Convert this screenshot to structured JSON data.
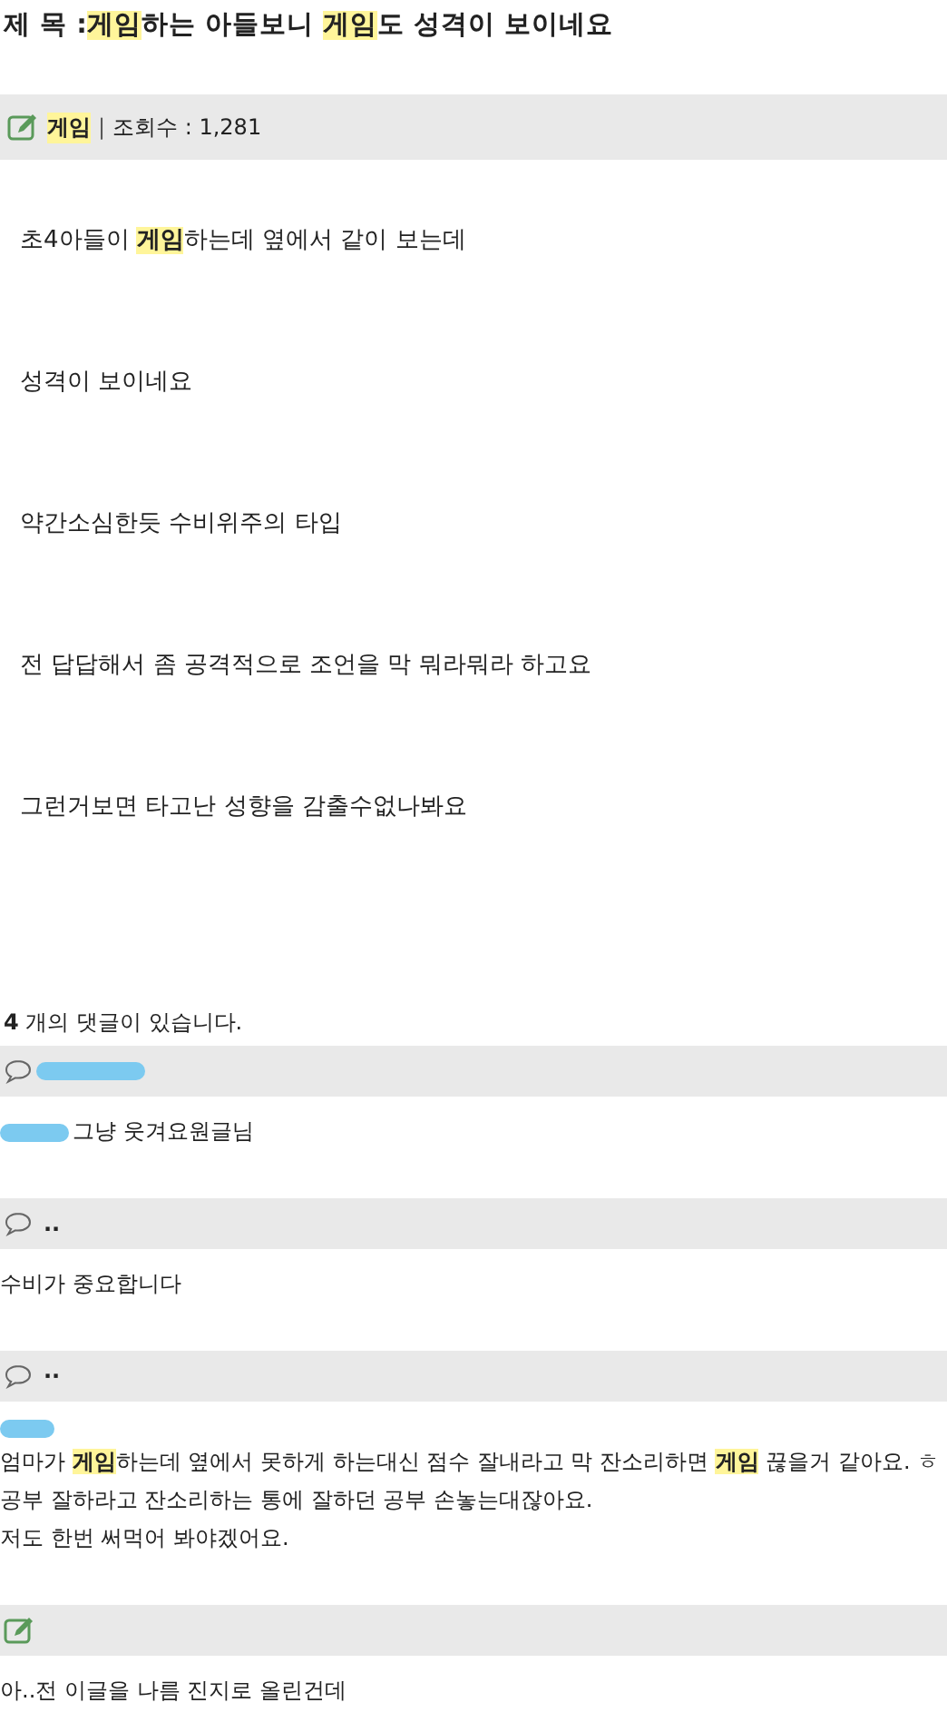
{
  "post": {
    "title_label": "제 목 :",
    "title": "**게임**하는 아들보니 **게임**도 성격이 보이네요",
    "category": "게임",
    "separator": "|",
    "views": "조회수 : 1,281",
    "paragraphs": [
      "초4아들이 **게임**하는데 옆에서 같이 보는데",
      "성격이 보이네요",
      "약간소심한듯 수비위주의 타입",
      "전 답답해서 좀 공격적으로 조언을 막 뭐라뭐라 하고요",
      "그런거보면 타고난 성향을 감출수없나봐요"
    ]
  },
  "comment_count": {
    "number": "4",
    "text": "개의 댓글이 있습니다."
  },
  "comments": [
    {
      "kind": "comment",
      "author_redacted": true,
      "body_redacted_inline": true,
      "body_redacted_above": false,
      "lines": [
        "그냥 웃겨요원글님"
      ]
    },
    {
      "kind": "comment",
      "author": "..",
      "author_redacted": false,
      "body_redacted_inline": false,
      "body_redacted_above": false,
      "lines": [
        "수비가 중요합니다"
      ]
    },
    {
      "kind": "comment",
      "author": "··",
      "author_redacted": false,
      "body_redacted_inline": false,
      "body_redacted_above": true,
      "lines": [
        "엄마가 **게임**하는데 옆에서 못하게 하는대신 점수 잘내라고 막 잔소리하면 **게임** 끊을거 같아요. ㅎ",
        "공부 잘하라고 잔소리하는 통에 잘하던 공부 손놓는대잖아요.",
        "저도 한번 써먹어 봐야겠어요."
      ]
    },
    {
      "kind": "edit",
      "author_redacted": false,
      "body_redacted_inline": false,
      "body_redacted_above": false,
      "lines": [
        "아..전 이글을 나름 진지로 올린건데"
      ]
    }
  ]
}
